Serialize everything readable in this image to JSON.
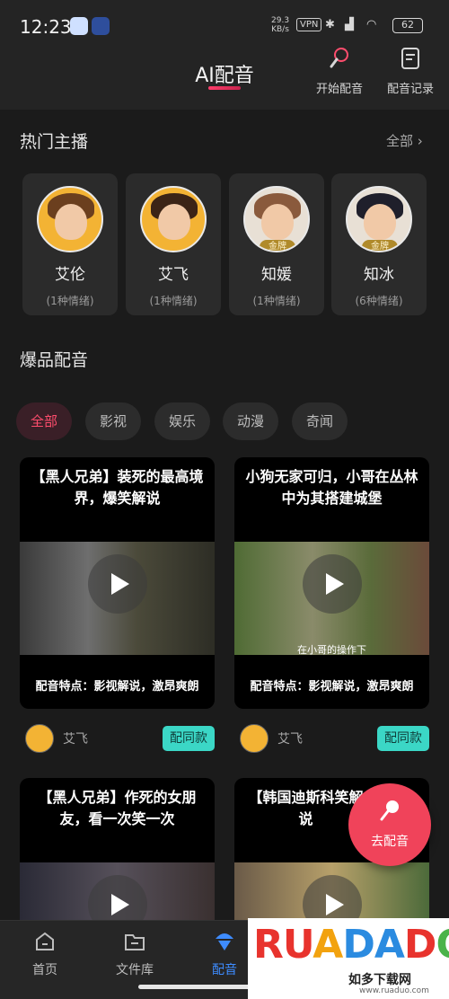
{
  "status": {
    "time": "12:23",
    "net_speed": "29.3",
    "net_unit": "KB/s",
    "vpn": "VPN",
    "battery": "62"
  },
  "header": {
    "title": "AI配音",
    "start_label": "开始配音",
    "record_label": "配音记录"
  },
  "hot": {
    "title": "热门主播",
    "all_label": "全部 ›",
    "anchors": [
      {
        "name": "艾伦",
        "sub": "(1种情绪)",
        "badge": "",
        "ring": "#f3b334",
        "hair": "#6b3f1e"
      },
      {
        "name": "艾飞",
        "sub": "(1种情绪)",
        "badge": "",
        "ring": "#f3b334",
        "hair": "#3b2416"
      },
      {
        "name": "知媛",
        "sub": "(1种情绪)",
        "badge": "金牌",
        "ring": "#e8e0d5",
        "hair": "#8a5a3c"
      },
      {
        "name": "知冰",
        "sub": "(6种情绪)",
        "badge": "金牌",
        "ring": "#e8e0d5",
        "hair": "#1f1f2b"
      }
    ]
  },
  "burst": {
    "title": "爆品配音",
    "chips": [
      "全部",
      "影视",
      "娱乐",
      "动漫",
      "奇闻"
    ]
  },
  "cards": [
    {
      "title": "【黑人兄弟】装死的最高境界，爆笑解说",
      "feature": "配音特点：影视解说，激昂爽朗",
      "caption": "",
      "author": "艾飞",
      "btn": "配同款"
    },
    {
      "title": "小狗无家可归，小哥在丛林中为其搭建城堡",
      "feature": "配音特点：影视解说，激昂爽朗",
      "caption": "在小哥的操作下",
      "author": "艾飞",
      "btn": "配同款"
    },
    {
      "title": "【黑人兄弟】作死的女朋友，看一次笑一次",
      "feature": "",
      "caption": "",
      "author": "",
      "btn": ""
    },
    {
      "title": "【韩国迪斯科笑解说",
      "feature": "",
      "caption": "",
      "author": "",
      "btn": ""
    }
  ],
  "fab": {
    "label": "去配音"
  },
  "nav": {
    "home": "首页",
    "library": "文件库",
    "dub": "配音"
  },
  "watermark": {
    "logo": "RUADADO",
    "sub": "如多下载网",
    "url": "www.ruaduo.com"
  },
  "colors": {
    "accent": "#ff4d6d",
    "teal": "#3bd7c6",
    "nav_active": "#3e8cff"
  }
}
